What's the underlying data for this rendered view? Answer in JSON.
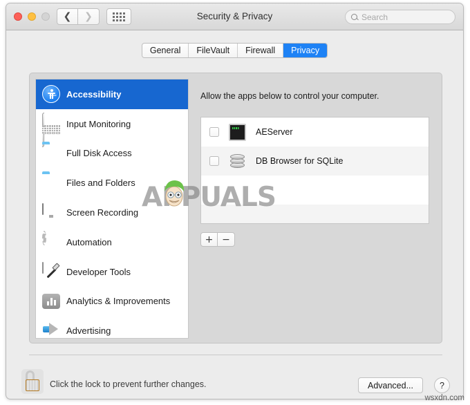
{
  "window": {
    "title": "Security & Privacy",
    "traffic_lights": [
      "close",
      "minimize",
      "zoom"
    ],
    "nav": {
      "back_icon": "chevron-left-icon",
      "forward_icon": "chevron-right-icon"
    },
    "grid_icon": "show-all-preferences-icon"
  },
  "search": {
    "placeholder": "Search",
    "icon": "search-icon",
    "value": ""
  },
  "tabs": [
    {
      "label": "General",
      "active": false
    },
    {
      "label": "FileVault",
      "active": false
    },
    {
      "label": "Firewall",
      "active": false
    },
    {
      "label": "Privacy",
      "active": true
    }
  ],
  "sidebar": {
    "items": [
      {
        "label": "Accessibility",
        "icon": "accessibility-icon",
        "selected": true
      },
      {
        "label": "Input Monitoring",
        "icon": "keyboard-icon",
        "selected": false
      },
      {
        "label": "Full Disk Access",
        "icon": "folder-icon",
        "selected": false
      },
      {
        "label": "Files and Folders",
        "icon": "folder-icon",
        "selected": false
      },
      {
        "label": "Screen Recording",
        "icon": "display-icon",
        "selected": false
      },
      {
        "label": "Automation",
        "icon": "gear-icon",
        "selected": false
      },
      {
        "label": "Developer Tools",
        "icon": "hammer-tools-icon",
        "selected": false
      },
      {
        "label": "Analytics & Improvements",
        "icon": "bar-chart-icon",
        "selected": false
      },
      {
        "label": "Advertising",
        "icon": "megaphone-icon",
        "selected": false
      }
    ]
  },
  "main": {
    "description": "Allow the apps below to control your computer.",
    "apps": [
      {
        "name": "AEServer",
        "icon": "terminal-icon",
        "checked": false
      },
      {
        "name": "DB Browser for SQLite",
        "icon": "database-icon",
        "checked": false
      }
    ],
    "add_label": "+",
    "remove_label": "−"
  },
  "footer": {
    "lock_icon": "unlocked-padlock-icon",
    "lock_text": "Click the lock to prevent further changes.",
    "advanced_label": "Advanced...",
    "help_label": "?"
  },
  "watermarks": {
    "brand": "APPUALS",
    "site": "wsxdn.com"
  },
  "colors": {
    "accent_blue": "#1e82f5",
    "selection_blue": "#1767d0",
    "window_bg": "#ececec",
    "panel_bg": "#d8d8d8"
  }
}
